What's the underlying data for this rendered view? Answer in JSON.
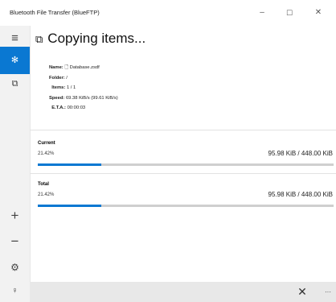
{
  "window": {
    "title": "Bluetooth File Transfer (BlueFTP)",
    "minimize_glyph": "–",
    "maximize_glyph": "☐",
    "close_glyph": "✕"
  },
  "sidebar": {
    "items": [
      {
        "name": "hamburger-menu-icon",
        "glyph": "≡",
        "active": false
      },
      {
        "name": "bluetooth-icon",
        "glyph": "✻",
        "active": true
      },
      {
        "name": "devices-icon",
        "glyph": "⧉",
        "active": false
      },
      {
        "name": "add-icon",
        "glyph": "+",
        "active": false
      },
      {
        "name": "remove-icon",
        "glyph": "−",
        "active": false
      },
      {
        "name": "settings-gear-icon",
        "glyph": "⚙",
        "active": false
      },
      {
        "name": "lightbulb-icon",
        "glyph": "♀",
        "active": false
      }
    ]
  },
  "header": {
    "icon": "copy-icon",
    "title": "Copying items..."
  },
  "details": {
    "name_label": "Name:",
    "name_value": "Database.zsdf",
    "folder_label": "Folder:",
    "folder_value": "/",
    "items_label": "Items:",
    "items_value": "1 / 1",
    "speed_label": "Speed:",
    "speed_value": "69.38 KiB/s (99.61 KiB/s)",
    "eta_label": "E.T.A.:",
    "eta_value": "00:00:03"
  },
  "current": {
    "title": "Current",
    "percent_text": "21.42%",
    "sizes": "95.98 KiB / 448.00 KiB",
    "progress": 0.2142
  },
  "total": {
    "title": "Total",
    "percent_text": "21.42%",
    "sizes": "95.98 KiB / 448.00 KiB",
    "progress": 0.2142
  },
  "bottom_bar": {
    "cancel_glyph": "✕",
    "more_glyph": "···"
  },
  "colors": {
    "accent": "#0a78d2",
    "track": "#cfcfcf",
    "sidebar_bg": "#f2f2f2",
    "bottombar_bg": "#e8e8e8"
  }
}
